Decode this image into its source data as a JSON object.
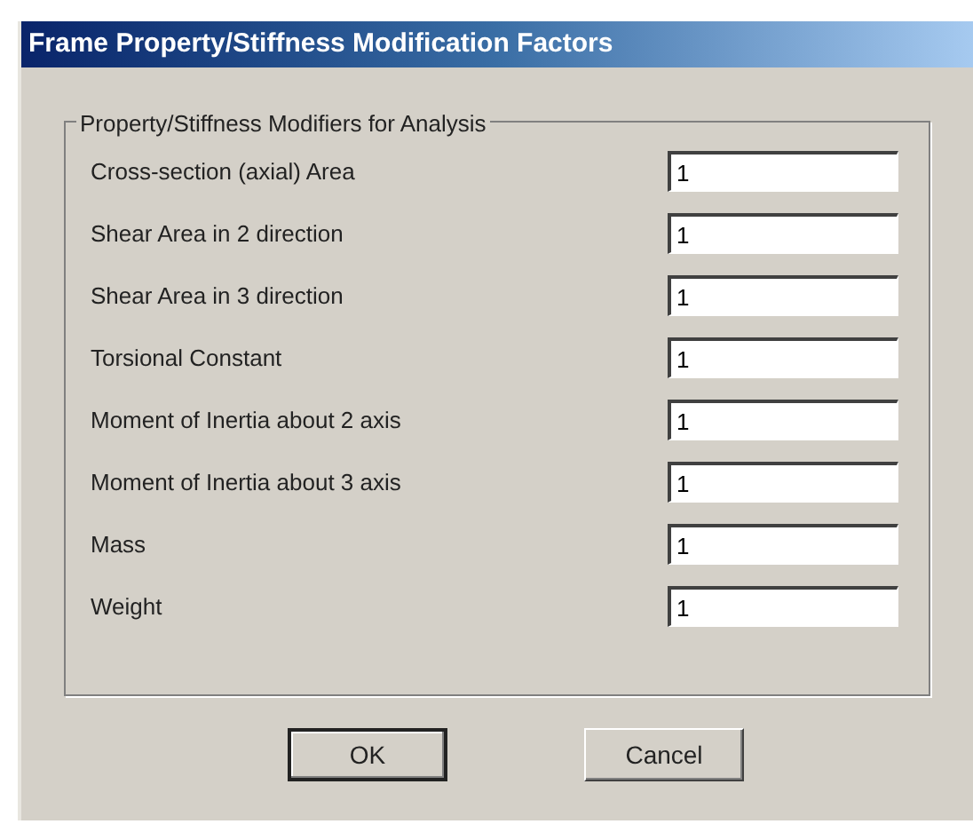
{
  "window": {
    "title": "Frame Property/Stiffness Modification Factors"
  },
  "group": {
    "title": "Property/Stiffness Modifiers for Analysis",
    "fields": [
      {
        "label": "Cross-section (axial) Area",
        "value": "1"
      },
      {
        "label": "Shear Area in 2 direction",
        "value": "1"
      },
      {
        "label": "Shear Area in 3 direction",
        "value": "1"
      },
      {
        "label": "Torsional Constant",
        "value": "1"
      },
      {
        "label": "Moment of Inertia about 2 axis",
        "value": "1"
      },
      {
        "label": "Moment of Inertia about 3 axis",
        "value": "1"
      },
      {
        "label": "Mass",
        "value": "1"
      },
      {
        "label": "Weight",
        "value": "1"
      }
    ]
  },
  "buttons": [
    {
      "label": "OK",
      "default": true
    },
    {
      "label": "Cancel",
      "default": false
    }
  ]
}
